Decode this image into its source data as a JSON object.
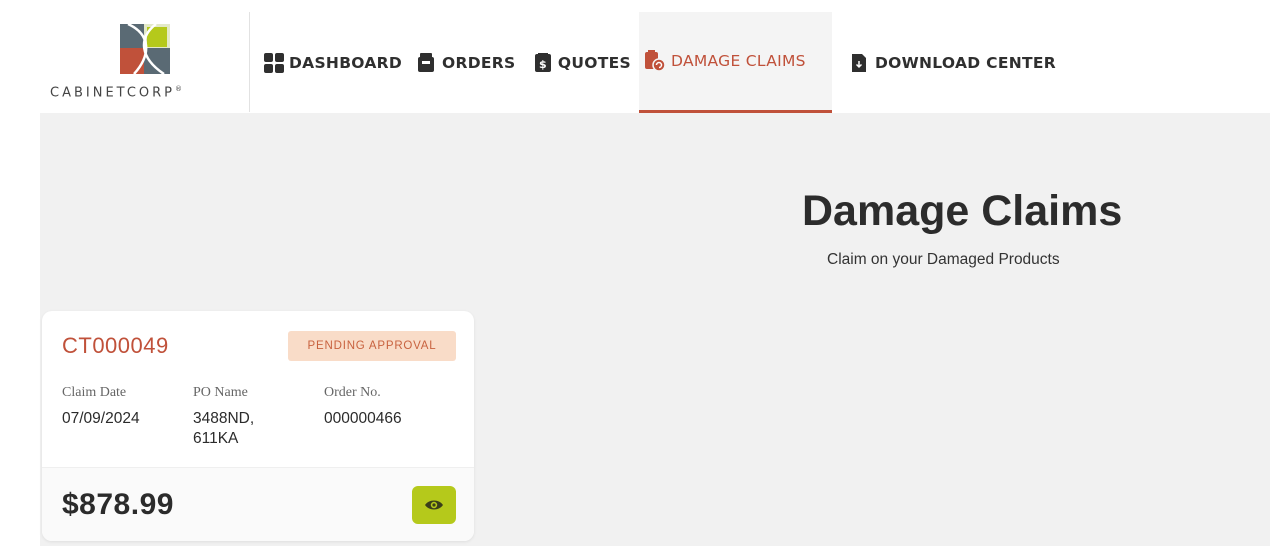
{
  "brand": {
    "name": "CABINETCORP",
    "trademark": "®",
    "colors": {
      "accent": "#c0513a",
      "lime": "#b5c91b",
      "slate": "#5a6a74"
    }
  },
  "nav": {
    "items": [
      {
        "label": "DASHBOARD",
        "icon": "grid-icon",
        "active": false
      },
      {
        "label": "ORDERS",
        "icon": "box-icon",
        "active": false
      },
      {
        "label": "QUOTES",
        "icon": "dollar-document-icon",
        "active": false
      },
      {
        "label": "DAMAGE CLAIMS",
        "icon": "damaged-box-icon",
        "active": true
      },
      {
        "label": "DOWNLOAD CENTER",
        "icon": "download-file-icon",
        "active": false
      }
    ]
  },
  "page": {
    "title": "Damage Claims",
    "subtitle": "Claim on your Damaged Products"
  },
  "claim": {
    "id": "CT000049",
    "status": "PENDING APPROVAL",
    "claim_date_label": "Claim Date",
    "claim_date": "07/09/2024",
    "po_name_label": "PO Name",
    "po_name": "3488ND, 611KA",
    "order_no_label": "Order No.",
    "order_no": "000000466",
    "amount": "$878.99",
    "view_icon": "eye-icon"
  }
}
